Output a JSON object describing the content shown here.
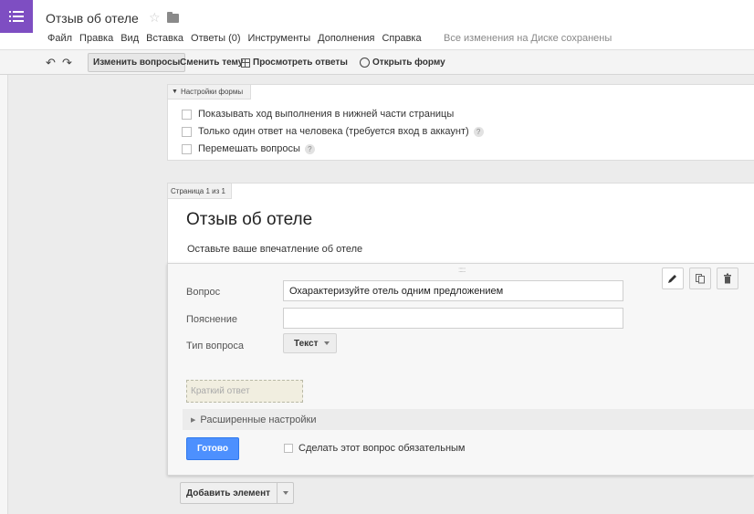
{
  "header": {
    "title": "Отзыв об отеле",
    "save_status": "Все изменения на Диске сохранены",
    "menu": [
      "Файл",
      "Правка",
      "Вид",
      "Вставка",
      "Ответы (0)",
      "Инструменты",
      "Дополнения",
      "Справка"
    ]
  },
  "toolbar": {
    "edit_questions": "Изменить вопросы",
    "change_theme": "Сменить тему",
    "view_responses": "Просмотреть ответы",
    "open_form": "Открыть форму"
  },
  "settings": {
    "tab_label": "Настройки формы",
    "options": [
      {
        "label": "Показывать ход выполнения в нижней части страницы",
        "checked": false
      },
      {
        "label": "Только один ответ на человека (требуется вход в аккаунт)",
        "checked": false
      },
      {
        "label": "Перемешать вопросы",
        "checked": false
      }
    ]
  },
  "page": {
    "tab_label": "Страница 1 из 1",
    "form_title": "Отзыв об отеле",
    "form_description": "Оставьте ваше впечатление об отеле"
  },
  "question": {
    "question_label": "Вопрос",
    "question_value": "Охарактеризуйте отель одним предложением",
    "help_label": "Пояснение",
    "help_value": "",
    "type_label": "Тип вопроса",
    "type_value": "Текст",
    "short_answer_placeholder": "Краткий ответ",
    "advanced_settings": "Расширенные настройки",
    "done_button": "Готово",
    "required_label": "Сделать этот вопрос обязательным",
    "required_checked": false
  },
  "add_element": {
    "label": "Добавить элемент"
  },
  "colors": {
    "brand": "#7e4ec2",
    "primary_button": "#4d90fe"
  }
}
